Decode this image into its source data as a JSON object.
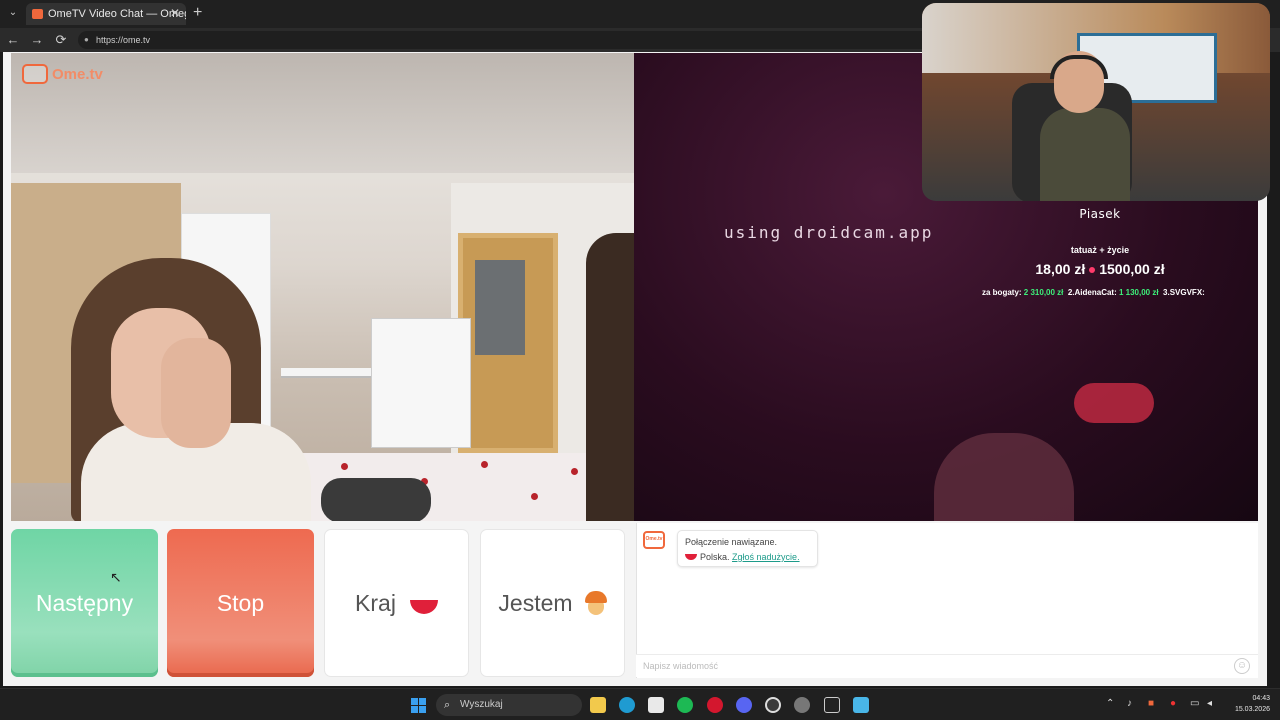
{
  "browser": {
    "tab_title": "OmeTV Video Chat — Omegle",
    "url": "https://ome.tv",
    "tab_close": "✕",
    "new_tab": "+",
    "tab_menu": "⌄",
    "nav": {
      "back": "←",
      "forward": "→",
      "reload": "⟳"
    }
  },
  "site": {
    "logo_text": "Ome.tv"
  },
  "remote_video": {
    "watermark": "using droidcam.app"
  },
  "stream_overlay": {
    "name": "Piasek",
    "goal_label": "tatuaż + życie",
    "goal_current": "18,00 zł",
    "goal_target": "1500,00 zł",
    "ranking": [
      {
        "text": "za bogaty:",
        "amount": "2 310,00 zł"
      },
      {
        "text": "2.AidenaCat:",
        "amount": "1 130,00 zł"
      },
      {
        "text": "3.SVGVFX:",
        "amount": ""
      }
    ]
  },
  "controls": {
    "next_label": "Następny",
    "stop_label": "Stop",
    "country_label": "Kraj",
    "gender_label": "Jestem"
  },
  "chat": {
    "icon_text": "Ome.tv",
    "status_line": "Połączenie nawiązane.",
    "country": "Polska.",
    "report_link": "Zgłoś nadużycie.",
    "input_placeholder": "Napisz wiadomość"
  },
  "taskbar": {
    "search_placeholder": "Wyszukaj",
    "time": "04:43",
    "date": "15.03.2026",
    "icons": [
      "windows-start-icon",
      "search-icon",
      "file-explorer-icon",
      "edge-icon",
      "store-icon",
      "spotify-icon",
      "opera-icon",
      "discord-icon",
      "obs-icon",
      "chrome-icon",
      "steam-icon",
      "notepad-icon"
    ]
  },
  "colors": {
    "next": "#6fd5a5",
    "stop": "#ee6a50",
    "brand": "#f0683c",
    "ranking_amount": "#3df07a"
  }
}
